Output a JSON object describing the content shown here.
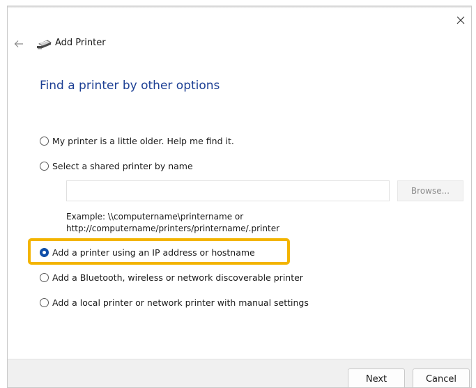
{
  "window": {
    "title": "Add Printer",
    "close_icon": "close-icon",
    "back_icon": "back-arrow-icon",
    "printer_icon": "printer-icon"
  },
  "page": {
    "heading": "Find a printer by other options"
  },
  "options": [
    {
      "label": "My printer is a little older. Help me find it.",
      "checked": false
    },
    {
      "label": "Select a shared printer by name",
      "checked": false
    },
    {
      "label": "Add a printer using an IP address or hostname",
      "checked": true
    },
    {
      "label": "Add a Bluetooth, wireless or network discoverable printer",
      "checked": false
    },
    {
      "label": "Add a local printer or network printer with manual settings",
      "checked": false
    }
  ],
  "shared_printer": {
    "input_value": "",
    "browse_label": "Browse...",
    "example_line1": "Example: \\\\computername\\printername or",
    "example_line2": "http://computername/printers/printername/.printer"
  },
  "footer": {
    "next_label": "Next",
    "cancel_label": "Cancel"
  },
  "colors": {
    "heading": "#1c3f94",
    "radio_selected": "#0f4ea8",
    "highlight": "#f3b400",
    "footer_bg": "#f0f0f0"
  }
}
